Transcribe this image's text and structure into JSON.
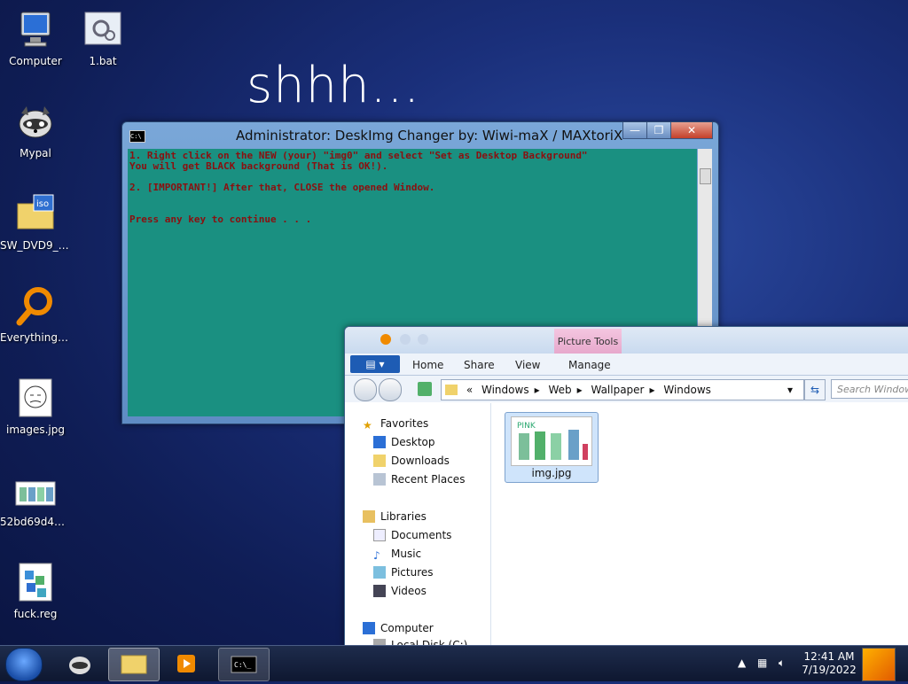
{
  "wallpaper_text": "shhh...",
  "desktop_icons": [
    {
      "label": "Computer"
    },
    {
      "label": "1.bat"
    },
    {
      "label": "Mypal"
    },
    {
      "label": "SW_DVD9_V..."
    },
    {
      "label": "Everything-..."
    },
    {
      "label": "images.jpg"
    },
    {
      "label": "52bd69d44..."
    },
    {
      "label": "fuck.reg"
    }
  ],
  "cmd_window": {
    "title": "Administrator:  DeskImg Changer by: Wiwi-maX / MAXtoriX",
    "icon_text": "C:\\",
    "minimize": "—",
    "maximize": "❐",
    "close": "✕",
    "lines": "1. Right click on the NEW (your) \"img0\" and select \"Set as Desktop Background\"\nYou will get BLACK background (That is OK!).\n\n2. [IMPORTANT!] After that, CLOSE the opened Window.\n\n\nPress any key to continue . . ."
  },
  "explorer": {
    "contextual_tab": "Picture Tools",
    "ribbon_tabs": {
      "home": "Home",
      "share": "Share",
      "view": "View",
      "manage": "Manage"
    },
    "file_menu": "▤ ▾",
    "address": {
      "prefix": "«",
      "parts": [
        "Windows",
        "Web",
        "Wallpaper",
        "Windows"
      ]
    },
    "search_placeholder": "Search Windows",
    "nav": {
      "favorites": "Favorites",
      "desktop": "Desktop",
      "downloads": "Downloads",
      "recent": "Recent Places",
      "libraries": "Libraries",
      "documents": "Documents",
      "music": "Music",
      "pictures": "Pictures",
      "videos": "Videos",
      "computer": "Computer",
      "local_disk": "Local Disk (C:)"
    },
    "file": {
      "name": "img.jpg",
      "thumb_text": "PINK"
    }
  },
  "taskbar": {
    "time": "12:41 AM",
    "date": "7/19/2022"
  },
  "colors": {
    "cmd_bg": "#1a9081",
    "cmd_text": "#8a1010",
    "desktop_bg": "#1a2f7a"
  }
}
